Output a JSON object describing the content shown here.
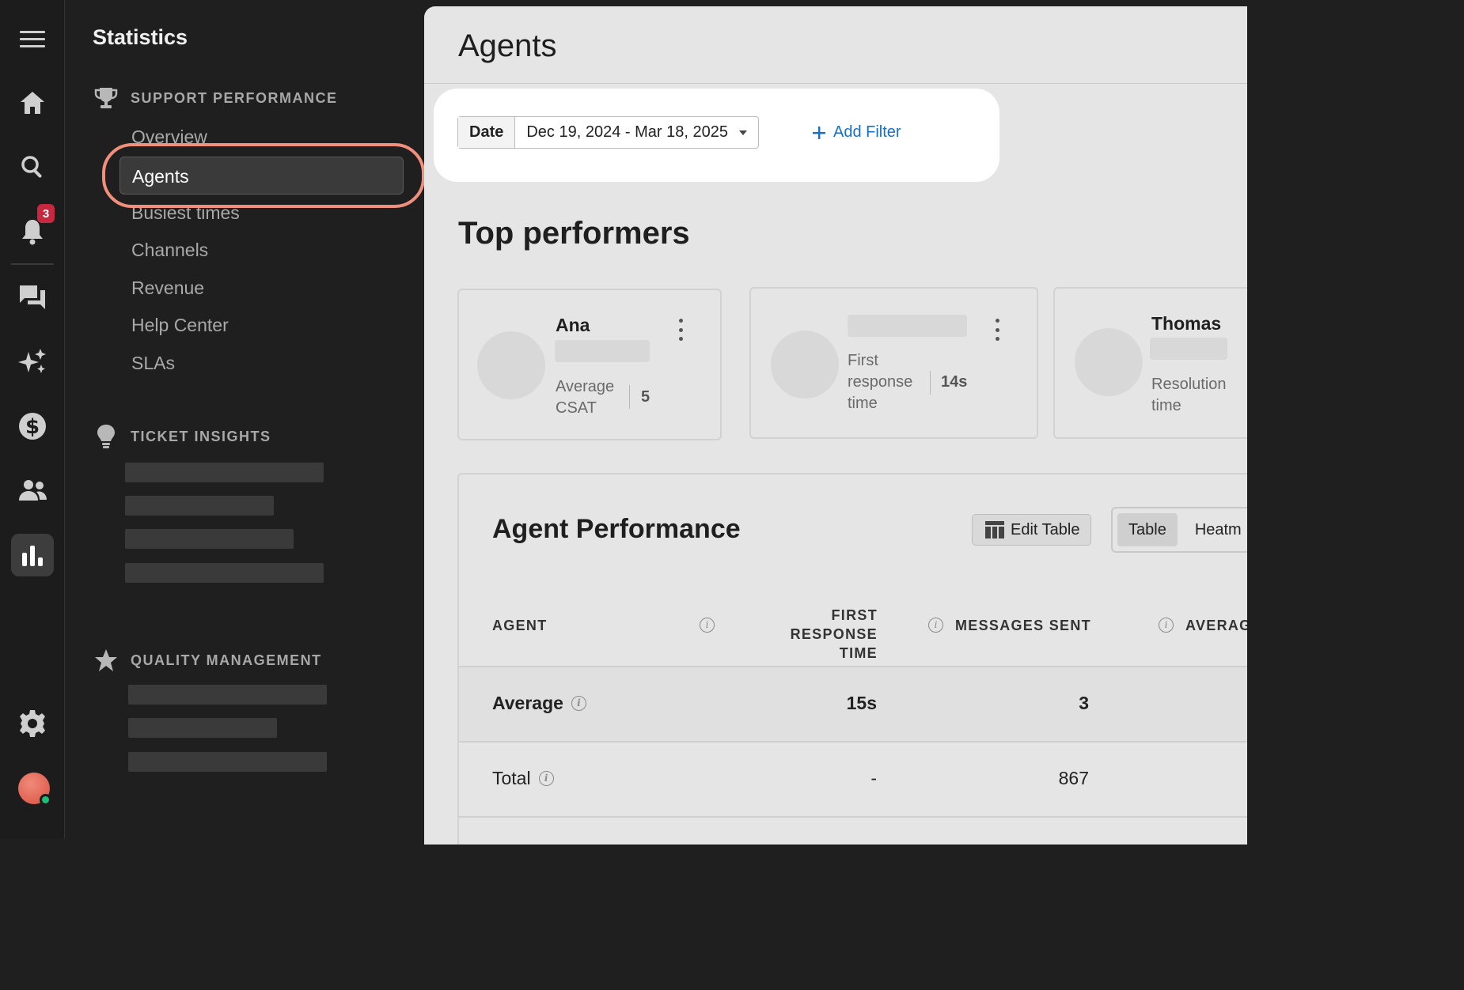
{
  "rail": {
    "notification_count": "3",
    "icons": [
      "menu-icon",
      "home-icon",
      "search-icon",
      "bell-icon",
      "chat-icon",
      "sparkle-icon",
      "dollar-icon",
      "people-icon",
      "bar-chart-icon",
      "gear-icon"
    ]
  },
  "nav": {
    "title": "Statistics",
    "support_performance": {
      "label": "SUPPORT PERFORMANCE",
      "items": [
        "Overview",
        "Agents",
        "Busiest times",
        "Channels",
        "Revenue",
        "Help Center",
        "SLAs"
      ]
    },
    "ticket_insights": {
      "label": "TICKET INSIGHTS"
    },
    "quality_management": {
      "label": "QUALITY MANAGEMENT"
    }
  },
  "header": {
    "title": "Agents"
  },
  "filters": {
    "date_label": "Date",
    "date_value": "Dec 19, 2024 - Mar 18, 2025",
    "add_filter": "Add Filter"
  },
  "top_performers": {
    "title": "Top performers",
    "cards": [
      {
        "name": "Ana",
        "metric_line1": "Average",
        "metric_line2": "CSAT",
        "value": "5"
      },
      {
        "name": "",
        "metric_line1": "First",
        "metric_line2": "response",
        "metric_line3": "time",
        "value": "14s"
      },
      {
        "name": "Thomas",
        "metric_line1": "Resolution",
        "metric_line2": "time",
        "value": ""
      }
    ]
  },
  "agent_performance": {
    "title": "Agent Performance",
    "edit_table": "Edit Table",
    "views": [
      "Table",
      "Heatm"
    ],
    "columns": {
      "agent": "AGENT",
      "frt_line1": "FIRST RESPONSE",
      "frt_line2": "TIME",
      "messages_sent": "MESSAGES SENT",
      "average": "AVERAG"
    },
    "rows": [
      {
        "label": "Average",
        "first_response_time": "15s",
        "messages_sent": "3"
      },
      {
        "label": "Total",
        "first_response_time": "-",
        "messages_sent": "867"
      }
    ]
  }
}
